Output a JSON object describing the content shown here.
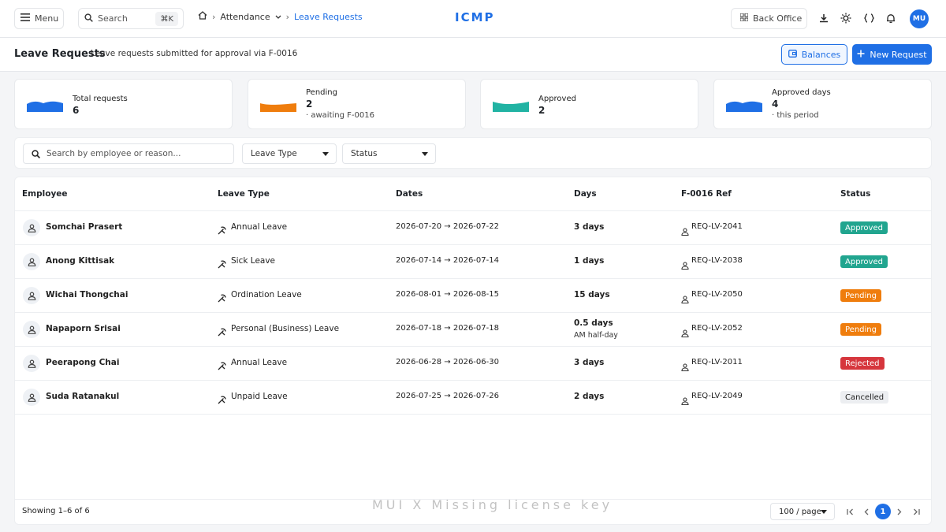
{
  "colors": {
    "accent": "#1f6fe5",
    "approved": "#21a58f",
    "pending": "#ef7d0d",
    "rejected": "#d6363d",
    "cancelled": "#eceef1"
  },
  "topbar": {
    "menu_label": "Menu",
    "search_label": "Search",
    "search_shortcut": "⌘K",
    "breadcrumb": {
      "section": "Attendance",
      "current": "Leave Requests"
    },
    "brand": "ICMP",
    "back_office_label": "Back Office",
    "user_initials": "MU",
    "icons": [
      "download-icon",
      "sun-icon",
      "code-icon",
      "bell-icon"
    ]
  },
  "header": {
    "title": "Leave Requests",
    "subtitle": "Leave requests submitted for approval via F-0016",
    "balances_label": "Balances",
    "new_request_label": "New Request"
  },
  "stats": [
    {
      "label": "Total requests",
      "value": "6",
      "note": "",
      "color": "#1f6fe5"
    },
    {
      "label": "Pending",
      "value": "2",
      "note": "· awaiting F-0016",
      "color": "#ef7d0d"
    },
    {
      "label": "Approved",
      "value": "2",
      "note": "",
      "color": "#21b3a3"
    },
    {
      "label": "Approved days",
      "value": "4",
      "note": "· this period",
      "color": "#1f6fe5"
    }
  ],
  "filters": {
    "search_placeholder": "Search by employee or reason...",
    "leave_type_label": "Leave Type",
    "status_label": "Status"
  },
  "table": {
    "columns": [
      "Employee",
      "Leave Type",
      "Dates",
      "Days",
      "F-0016 Ref",
      "Status"
    ],
    "rows": [
      {
        "employee": "Somchai Prasert",
        "leave_type": "Annual Leave",
        "dates": "2026-07-20 → 2026-07-22",
        "days": "3 days",
        "days_note": "",
        "ref": "REQ-LV-2041",
        "status": "Approved",
        "status_kind": "approved"
      },
      {
        "employee": "Anong Kittisak",
        "leave_type": "Sick Leave",
        "dates": "2026-07-14 → 2026-07-14",
        "days": "1 days",
        "days_note": "",
        "ref": "REQ-LV-2038",
        "status": "Approved",
        "status_kind": "approved"
      },
      {
        "employee": "Wichai Thongchai",
        "leave_type": "Ordination Leave",
        "dates": "2026-08-01 → 2026-08-15",
        "days": "15 days",
        "days_note": "",
        "ref": "REQ-LV-2050",
        "status": "Pending",
        "status_kind": "pending"
      },
      {
        "employee": "Napaporn Srisai",
        "leave_type": "Personal (Business) Leave",
        "dates": "2026-07-18 → 2026-07-18",
        "days": "0.5 days",
        "days_note": "AM half-day",
        "ref": "REQ-LV-2052",
        "status": "Pending",
        "status_kind": "pending"
      },
      {
        "employee": "Peerapong Chai",
        "leave_type": "Annual Leave",
        "dates": "2026-06-28 → 2026-06-30",
        "days": "3 days",
        "days_note": "",
        "ref": "REQ-LV-2011",
        "status": "Rejected",
        "status_kind": "rejected"
      },
      {
        "employee": "Suda Ratanakul",
        "leave_type": "Unpaid Leave",
        "dates": "2026-07-25 → 2026-07-26",
        "days": "2 days",
        "days_note": "",
        "ref": "REQ-LV-2049",
        "status": "Cancelled",
        "status_kind": "cancelled"
      }
    ],
    "watermark": "MUI X Missing license key"
  },
  "footer": {
    "showing": "Showing 1–6 of 6",
    "per_page": "100 / page",
    "current_page": "1"
  }
}
